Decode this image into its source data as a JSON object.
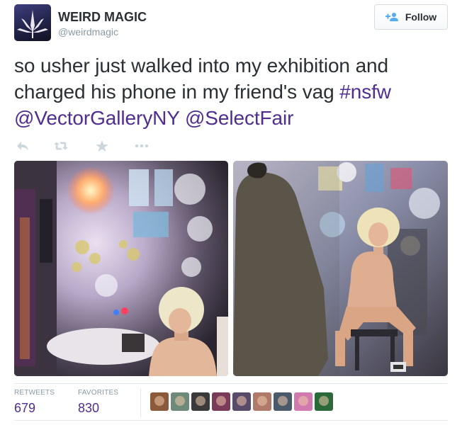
{
  "account": {
    "name": "WEIRD MAGIC",
    "handle": "@weirdmagic"
  },
  "follow_button": {
    "label": "Follow",
    "icon": "follow-person-plus-icon"
  },
  "tweet": {
    "text_plain": "so usher just walked into my exhibition and charged his phone in my friend's vag ",
    "hashtag": "#nsfw",
    "mention1": "@VectorGalleryNY",
    "mention2": "@SelectFair",
    "link_color": "#4f2d91"
  },
  "actions": [
    {
      "icon": "reply-icon"
    },
    {
      "icon": "retweet-icon"
    },
    {
      "icon": "favorite-star-icon"
    },
    {
      "icon": "more-dots-icon"
    }
  ],
  "stats": {
    "retweets_label": "RETWEETS",
    "retweets_count": "679",
    "favorites_label": "FAVORITES",
    "favorites_count": "830"
  },
  "favoriters": [
    {
      "color": "#8a5a3a"
    },
    {
      "color": "#6d8a7a"
    },
    {
      "color": "#3a3a3a"
    },
    {
      "color": "#7a3a5a"
    },
    {
      "color": "#5a4a6a"
    },
    {
      "color": "#b07a6a"
    },
    {
      "color": "#4a5a6a"
    },
    {
      "color": "#d07ab0"
    },
    {
      "color": "#2a6a3a"
    }
  ]
}
